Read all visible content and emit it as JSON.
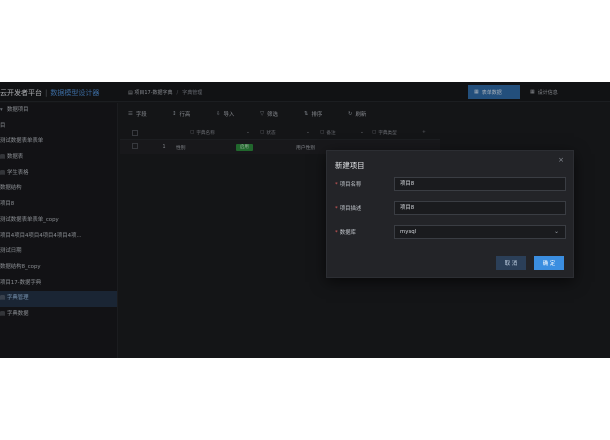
{
  "brand": {
    "title": "云开发者平台",
    "subtitle": "数据模型设计器"
  },
  "breadcrumb": {
    "project": "项目17-数据字典",
    "current": "字典管理"
  },
  "top_tabs": [
    {
      "label": "表单数据",
      "icon": "table-icon",
      "active": true
    },
    {
      "label": "设计信息",
      "icon": "grid-icon",
      "active": false
    }
  ],
  "sidebar": {
    "items": [
      {
        "label": "数据项目",
        "icon": "folder-icon",
        "active": false
      },
      {
        "label": "目",
        "icon": "",
        "active": false
      },
      {
        "label": "测试数据表单表单",
        "icon": "",
        "active": false
      },
      {
        "label": "数据表",
        "icon": "table-icon",
        "active": false
      },
      {
        "label": "学生表格",
        "icon": "table-icon",
        "active": false
      },
      {
        "label": "数据结构",
        "icon": "",
        "active": false
      },
      {
        "label": "项目8",
        "icon": "",
        "active": false
      },
      {
        "label": "测试数据表单表单_copy",
        "icon": "",
        "active": false
      },
      {
        "label": "项目4项目4项目4项目4项目4项...",
        "icon": "",
        "active": false
      },
      {
        "label": "测试日期",
        "icon": "",
        "active": false
      },
      {
        "label": "数据结构8_copy",
        "icon": "",
        "active": false
      },
      {
        "label": "项目17-数据字典",
        "icon": "",
        "active": false
      },
      {
        "label": "字典管理",
        "icon": "table-icon",
        "active": true
      },
      {
        "label": "字典数据",
        "icon": "table-icon",
        "active": false
      }
    ]
  },
  "toolbar": [
    {
      "label": "字段",
      "icon": "list-icon"
    },
    {
      "label": "行高",
      "icon": "row-height-icon"
    },
    {
      "label": "导入",
      "icon": "import-icon"
    },
    {
      "label": "筛选",
      "icon": "filter-icon"
    },
    {
      "label": "排序",
      "icon": "sort-icon"
    },
    {
      "label": "刷新",
      "icon": "refresh-icon"
    }
  ],
  "grid": {
    "columns": [
      "字典名称",
      "状态",
      "备注",
      "字典类型"
    ],
    "rows": [
      {
        "index": "1",
        "name": "性别",
        "status": "启用",
        "note": "用户性别"
      }
    ]
  },
  "modal": {
    "title": "新建项目",
    "close": "×",
    "fields": [
      {
        "label": "项目名称",
        "value": "项目8",
        "required": true
      },
      {
        "label": "项目描述",
        "value": "项目8",
        "required": true
      },
      {
        "label": "数据库",
        "value": "mysql",
        "required": true
      }
    ],
    "cancel_label": "取 消",
    "ok_label": "确 定"
  },
  "colors": {
    "accent": "#3b8ee0",
    "status_enabled": "#2c8a3c",
    "background": "#1b1c1f"
  }
}
